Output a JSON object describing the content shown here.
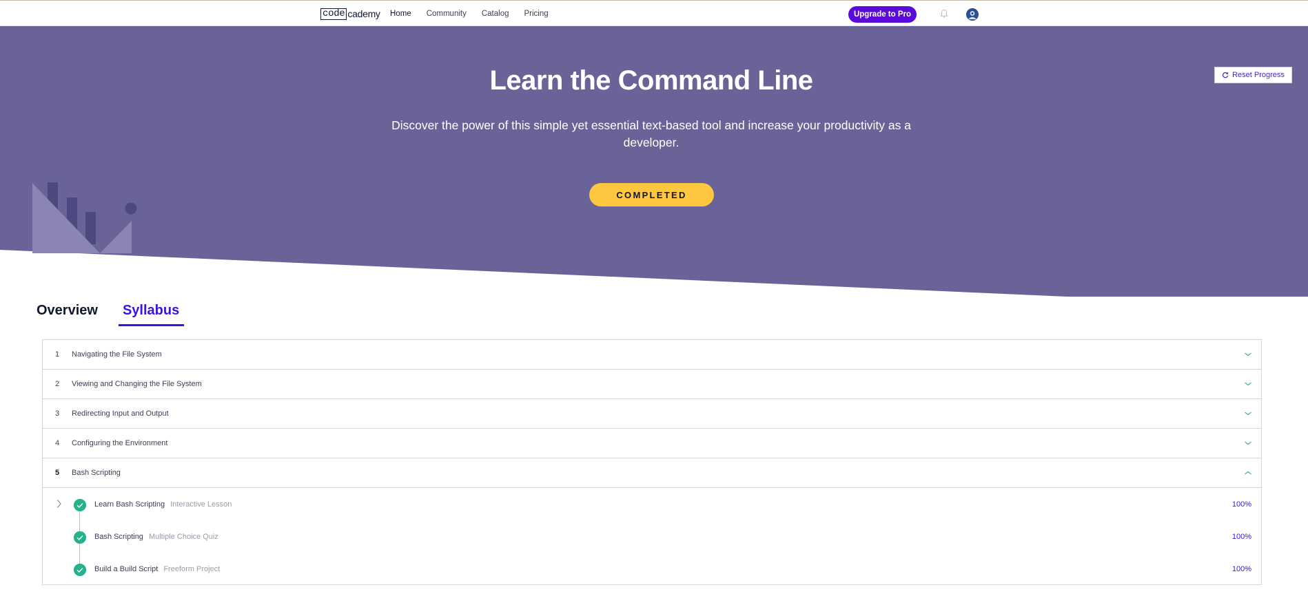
{
  "nav": {
    "logo_box": "code",
    "logo_rest": "cademy",
    "links": [
      "Home",
      "Community",
      "Catalog",
      "Pricing"
    ],
    "upgrade": "Upgrade to Pro"
  },
  "hero": {
    "reset_label": "Reset Progress",
    "title": "Learn the Command Line",
    "subtitle": "Discover the power of this simple yet essential text-based tool and increase your productivity as a developer.",
    "status": "COMPLETED",
    "colors": {
      "bg": "#6a6398",
      "decor": "#8a85b5",
      "decor_dark": "#4e4880",
      "status": "#ffc740"
    }
  },
  "tabs": [
    "Overview",
    "Syllabus"
  ],
  "modules": [
    {
      "num": "1",
      "title": "Navigating the File System"
    },
    {
      "num": "2",
      "title": "Viewing and Changing the File System"
    },
    {
      "num": "3",
      "title": "Redirecting Input and Output"
    },
    {
      "num": "4",
      "title": "Configuring the Environment"
    },
    {
      "num": "5",
      "title": "Bash Scripting"
    }
  ],
  "lessons": [
    {
      "name": "Learn Bash Scripting",
      "type": "Interactive Lesson",
      "progress": "100%"
    },
    {
      "name": "Bash Scripting",
      "type": "Multiple Choice Quiz",
      "progress": "100%"
    },
    {
      "name": "Build a Build Script",
      "type": "Freeform Project",
      "progress": "100%"
    }
  ]
}
